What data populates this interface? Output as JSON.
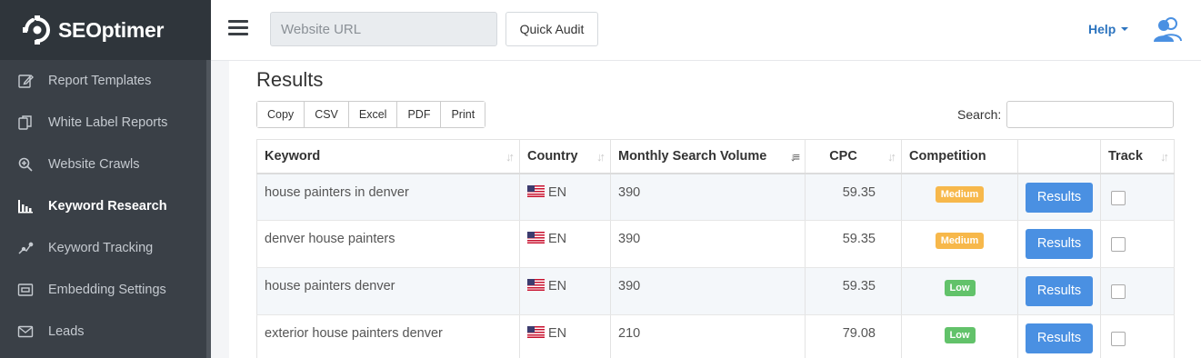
{
  "app": {
    "logo_text": "SEOptimer"
  },
  "sidebar": {
    "items": [
      {
        "label": "Report Templates",
        "icon": "edit-icon",
        "active": false
      },
      {
        "label": "White Label Reports",
        "icon": "copy-icon",
        "active": false
      },
      {
        "label": "Website Crawls",
        "icon": "search-icon",
        "active": false
      },
      {
        "label": "Keyword Research",
        "icon": "bar-chart-icon",
        "active": true
      },
      {
        "label": "Keyword Tracking",
        "icon": "trend-icon",
        "active": false
      },
      {
        "label": "Embedding Settings",
        "icon": "embed-icon",
        "active": false
      },
      {
        "label": "Leads",
        "icon": "mail-icon",
        "active": false
      }
    ]
  },
  "topbar": {
    "url_placeholder": "Website URL",
    "quick_audit_label": "Quick Audit",
    "help_label": "Help"
  },
  "main": {
    "title": "Results",
    "export_buttons": [
      "Copy",
      "CSV",
      "Excel",
      "PDF",
      "Print"
    ],
    "search_label": "Search:",
    "columns": [
      "Keyword",
      "Country",
      "Monthly Search Volume",
      "CPC",
      "Competition",
      "",
      "Track"
    ],
    "rows": [
      {
        "keyword": "house painters in denver",
        "country": "EN",
        "volume": "390",
        "cpc": "59.35",
        "competition": "Medium",
        "action": "Results"
      },
      {
        "keyword": "denver house painters",
        "country": "EN",
        "volume": "390",
        "cpc": "59.35",
        "competition": "Medium",
        "action": "Results"
      },
      {
        "keyword": "house painters denver",
        "country": "EN",
        "volume": "390",
        "cpc": "59.35",
        "competition": "Low",
        "action": "Results"
      },
      {
        "keyword": "exterior house painters denver",
        "country": "EN",
        "volume": "210",
        "cpc": "79.08",
        "competition": "Low",
        "action": "Results"
      }
    ]
  },
  "colors": {
    "accent": "#4a90e2",
    "medium": "#f7b84b",
    "low": "#62c26a",
    "sidebar": "#3a4047",
    "help": "#2c74bf"
  }
}
